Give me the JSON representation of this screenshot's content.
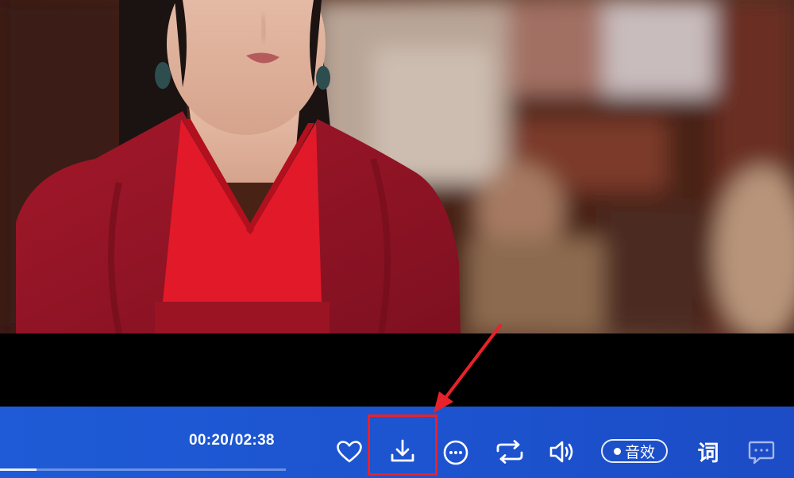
{
  "player": {
    "time": {
      "current": "00:20",
      "separator": "/",
      "total": "02:38"
    },
    "progress_fraction": 0.127,
    "sound_effect_label": "音效",
    "lyrics_label": "词",
    "icons": {
      "favorite": "heart-icon",
      "download": "download-icon",
      "more": "more-options-icon",
      "repeat": "repeat-icon",
      "volume": "volume-icon",
      "comment": "comment-icon"
    }
  },
  "colors": {
    "control_bar": "#1f5bd6",
    "annotation": "#e8222a",
    "icon": "#ffffff"
  }
}
